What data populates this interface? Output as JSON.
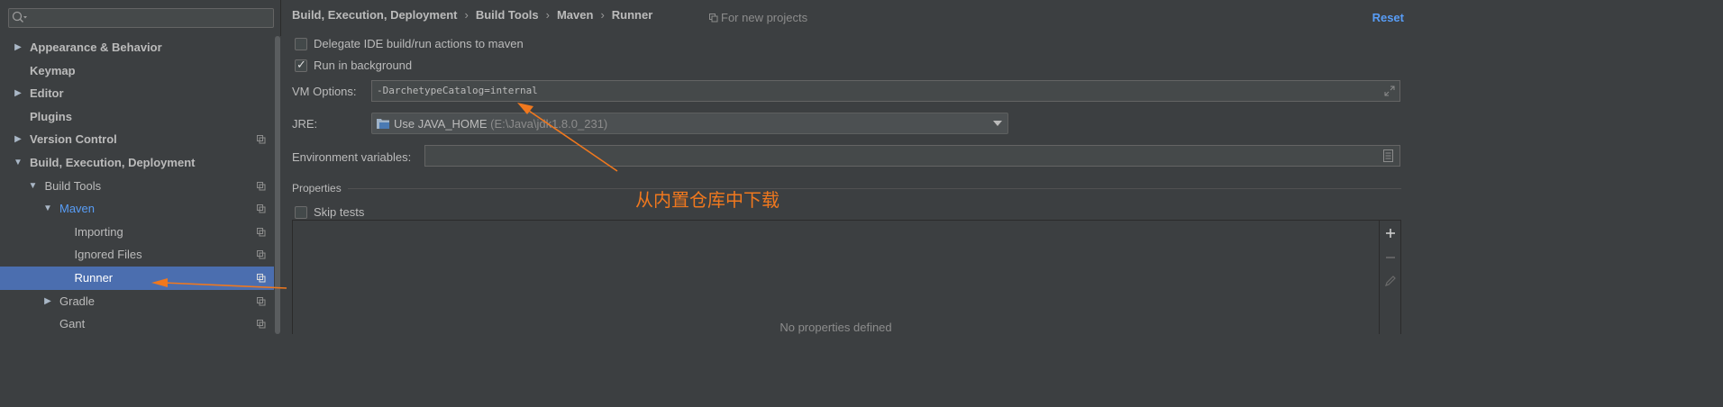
{
  "sidebar": {
    "search": {
      "value": "",
      "placeholder": ""
    },
    "items": [
      {
        "label": "Appearance & Behavior",
        "bold": true,
        "arrow": "right",
        "indent": 0,
        "copy": false
      },
      {
        "label": "Keymap",
        "bold": true,
        "arrow": "",
        "indent": 0,
        "copy": false
      },
      {
        "label": "Editor",
        "bold": true,
        "arrow": "right",
        "indent": 0,
        "copy": false
      },
      {
        "label": "Plugins",
        "bold": true,
        "arrow": "",
        "indent": 0,
        "copy": false
      },
      {
        "label": "Version Control",
        "bold": true,
        "arrow": "right",
        "indent": 0,
        "copy": true
      },
      {
        "label": "Build, Execution, Deployment",
        "bold": true,
        "arrow": "down",
        "indent": 0,
        "copy": false
      },
      {
        "label": "Build Tools",
        "bold": false,
        "arrow": "down",
        "indent": 1,
        "copy": true
      },
      {
        "label": "Maven",
        "bold": false,
        "arrow": "down",
        "indent": 2,
        "copy": true,
        "highlight": true
      },
      {
        "label": "Importing",
        "bold": false,
        "arrow": "",
        "indent": 3,
        "copy": true
      },
      {
        "label": "Ignored Files",
        "bold": false,
        "arrow": "",
        "indent": 3,
        "copy": true
      },
      {
        "label": "Runner",
        "bold": false,
        "arrow": "",
        "indent": 3,
        "copy": true,
        "selected": true
      },
      {
        "label": "Gradle",
        "bold": false,
        "arrow": "right",
        "indent": 2,
        "copy": true
      },
      {
        "label": "Gant",
        "bold": false,
        "arrow": "",
        "indent": 2,
        "copy": true
      }
    ]
  },
  "header": {
    "breadcrumb": [
      "Build, Execution, Deployment",
      "Build Tools",
      "Maven",
      "Runner"
    ],
    "breadcrumb_separator": "›",
    "for_new_projects": "For new projects",
    "reset": "Reset"
  },
  "options": {
    "delegate": {
      "label": "Delegate IDE build/run actions to maven",
      "checked": false
    },
    "background": {
      "label": "Run in background",
      "checked": true
    },
    "vm_label": "VM Options:",
    "vm_value": "-DarchetypeCatalog=internal",
    "jre_label": "JRE:",
    "jre_value": "Use JAVA_HOME",
    "jre_path": "(E:\\Java\\jdk1.8.0_231)",
    "env_label": "Environment variables:",
    "env_value": "",
    "properties_title": "Properties",
    "skip_tests": {
      "label": "Skip tests",
      "checked": false
    },
    "no_properties": "No properties defined"
  },
  "annotation": {
    "text": "从内置仓库中下载",
    "color": "#f0781e"
  },
  "colors": {
    "selection": "#4b6eaf",
    "link": "#589df6",
    "background": "#3c3f41"
  }
}
